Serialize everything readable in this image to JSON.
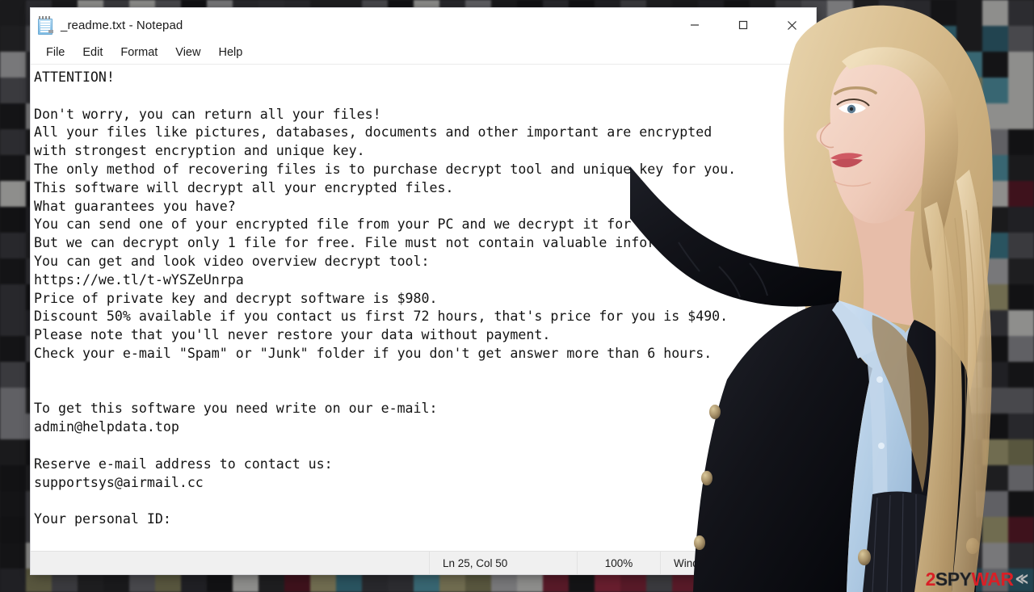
{
  "window": {
    "title": "_readme.txt - Notepad",
    "icon": "notepad-icon",
    "controls": {
      "minimize": "minimize-icon",
      "maximize": "maximize-icon",
      "close": "close-icon"
    }
  },
  "menu": {
    "items": [
      {
        "label": "File"
      },
      {
        "label": "Edit"
      },
      {
        "label": "Format"
      },
      {
        "label": "View"
      },
      {
        "label": "Help"
      }
    ]
  },
  "document": {
    "lines": [
      "ATTENTION!",
      "",
      "Don't worry, you can return all your files!",
      "All your files like pictures, databases, documents and other important are encrypted",
      "with strongest encryption and unique key.",
      "The only method of recovering files is to purchase decrypt tool and unique key for you.",
      "This software will decrypt all your encrypted files.",
      "What guarantees you have?",
      "You can send one of your encrypted file from your PC and we decrypt it for free.",
      "But we can decrypt only 1 file for free. File must not contain valuable information.",
      "You can get and look video overview decrypt tool:",
      "https://we.tl/t-wYSZeUnrpa",
      "Price of private key and decrypt software is $980.",
      "Discount 50% available if you contact us first 72 hours, that's price for you is $490.",
      "Please note that you'll never restore your data without payment.",
      "Check your e-mail \"Spam\" or \"Junk\" folder if you don't get answer more than 6 hours.",
      "",
      "",
      "To get this software you need write on our e-mail:",
      "admin@helpdata.top",
      "",
      "Reserve e-mail address to contact us:",
      "supportsys@airmail.cc",
      "",
      "Your personal ID:"
    ]
  },
  "statusbar": {
    "cursor": "Ln 25, Col 50",
    "zoom": "100%",
    "line_ending": "Windows (CRLF)"
  },
  "scrollbar": {
    "up_arrow": "scroll-up-arrow",
    "down_arrow": "scroll-down-arrow"
  },
  "watermark": {
    "part1": "2",
    "part2": "SPY",
    "part3": "WAR",
    "part4": "≪"
  },
  "colors": {
    "accent_red": "#d91f26",
    "window_bg": "#ffffff",
    "text": "#141414",
    "statusbar_bg": "#f0f0f0",
    "desktop_bg": "#1c1c1e"
  }
}
